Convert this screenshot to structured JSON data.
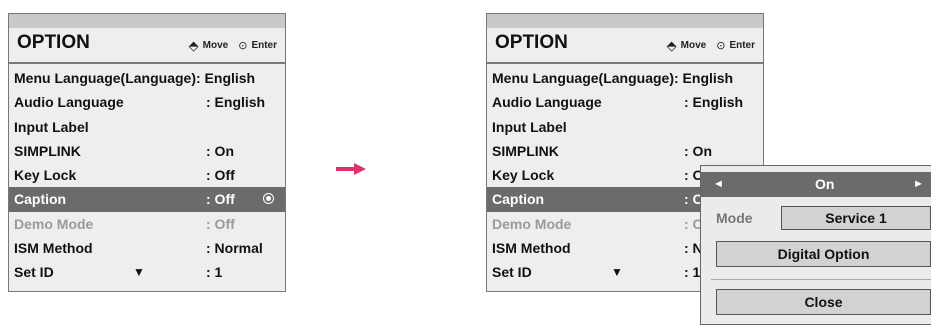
{
  "left_panel": {
    "title": "OPTION",
    "hint_move": "Move",
    "hint_enter": "Enter",
    "items": [
      {
        "label": "Menu Language(Language): English",
        "value": ""
      },
      {
        "label": "Audio Language",
        "value": ": English"
      },
      {
        "label": "Input Label",
        "value": ""
      },
      {
        "label": "SIMPLINK",
        "value": ": On"
      },
      {
        "label": "Key Lock",
        "value": ": Off"
      },
      {
        "label": "Caption",
        "value": ": Off"
      },
      {
        "label": "Demo Mode",
        "value": ": Off"
      },
      {
        "label": "ISM Method",
        "value": ": Normal"
      },
      {
        "label": "Set ID",
        "value": ": 1"
      }
    ]
  },
  "right_panel": {
    "title": "OPTION",
    "hint_move": "Move",
    "hint_enter": "Enter",
    "items": [
      {
        "label": "Menu Language(Language): English",
        "value": ""
      },
      {
        "label": "Audio Language",
        "value": ": English"
      },
      {
        "label": "Input Label",
        "value": ""
      },
      {
        "label": "SIMPLINK",
        "value": ": On"
      },
      {
        "label": "Key Lock",
        "value": ": O"
      },
      {
        "label": "Caption",
        "value": ": C"
      },
      {
        "label": "Demo Mode",
        "value": ": C"
      },
      {
        "label": "ISM Method",
        "value": ": N"
      },
      {
        "label": "Set ID",
        "value": ": 1"
      }
    ]
  },
  "popup": {
    "value": "On",
    "left_arrow": "◄",
    "right_arrow": "►",
    "mode_label": "Mode",
    "mode_value": "Service 1",
    "digital_option": "Digital Option",
    "close": "Close"
  },
  "colors": {
    "panel_bg": "#eeeeee",
    "selected_bg": "#6b6b6b",
    "disabled_text": "#9a9a9a",
    "arrow": "#e0316a"
  },
  "icons": {
    "move": "dpad-icon",
    "enter": "enter-icon",
    "scroll": "down-arrow-icon",
    "transition": "right-arrow-icon"
  }
}
